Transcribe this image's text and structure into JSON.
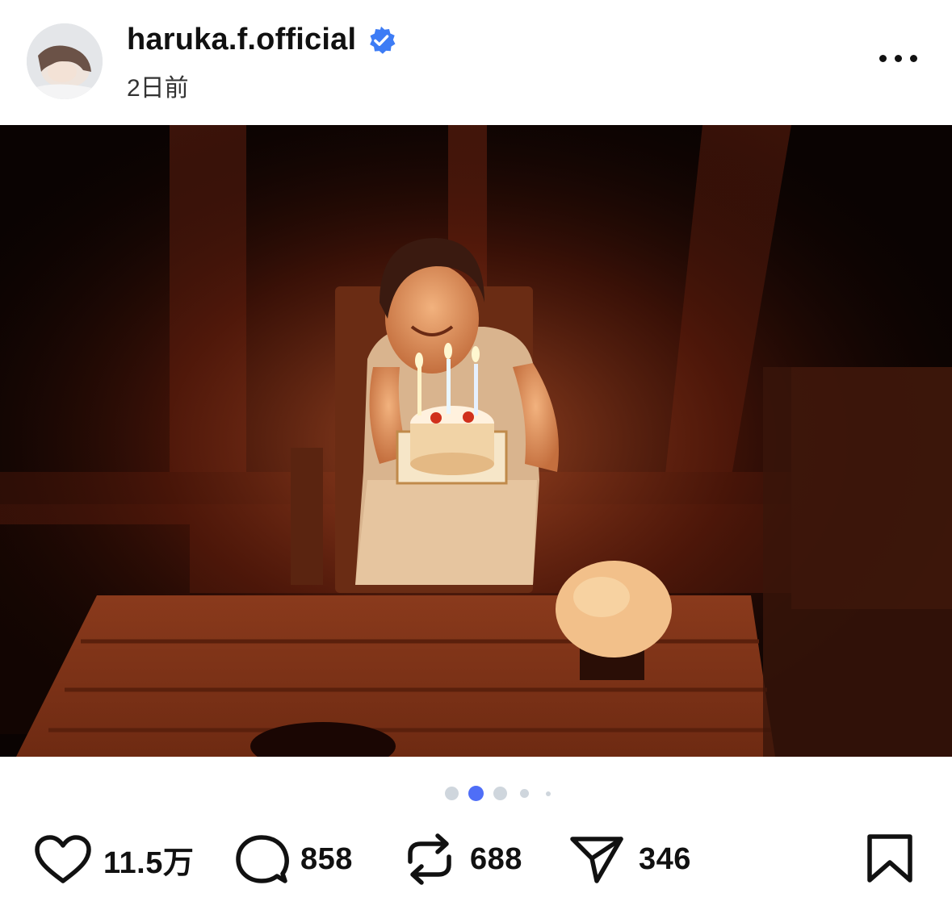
{
  "header": {
    "username": "haruka.f.official",
    "time_ago": "2日前",
    "verified_icon": "verified-badge-icon",
    "more_icon": "more-horizontal-icon"
  },
  "carousel": {
    "total": 5,
    "active_index": 1,
    "active_color": "#4f6ef7",
    "inactive_color": "#cfd6dd"
  },
  "actions": {
    "likes": {
      "icon": "heart-icon",
      "count": "11.5万"
    },
    "replies": {
      "icon": "comment-icon",
      "count": "858"
    },
    "reposts": {
      "icon": "repost-icon",
      "count": "688"
    },
    "shares": {
      "icon": "send-icon",
      "count": "346"
    },
    "bookmark": {
      "icon": "bookmark-icon"
    }
  },
  "colors": {
    "verified": "#3d7cf5",
    "text": "#111111"
  }
}
